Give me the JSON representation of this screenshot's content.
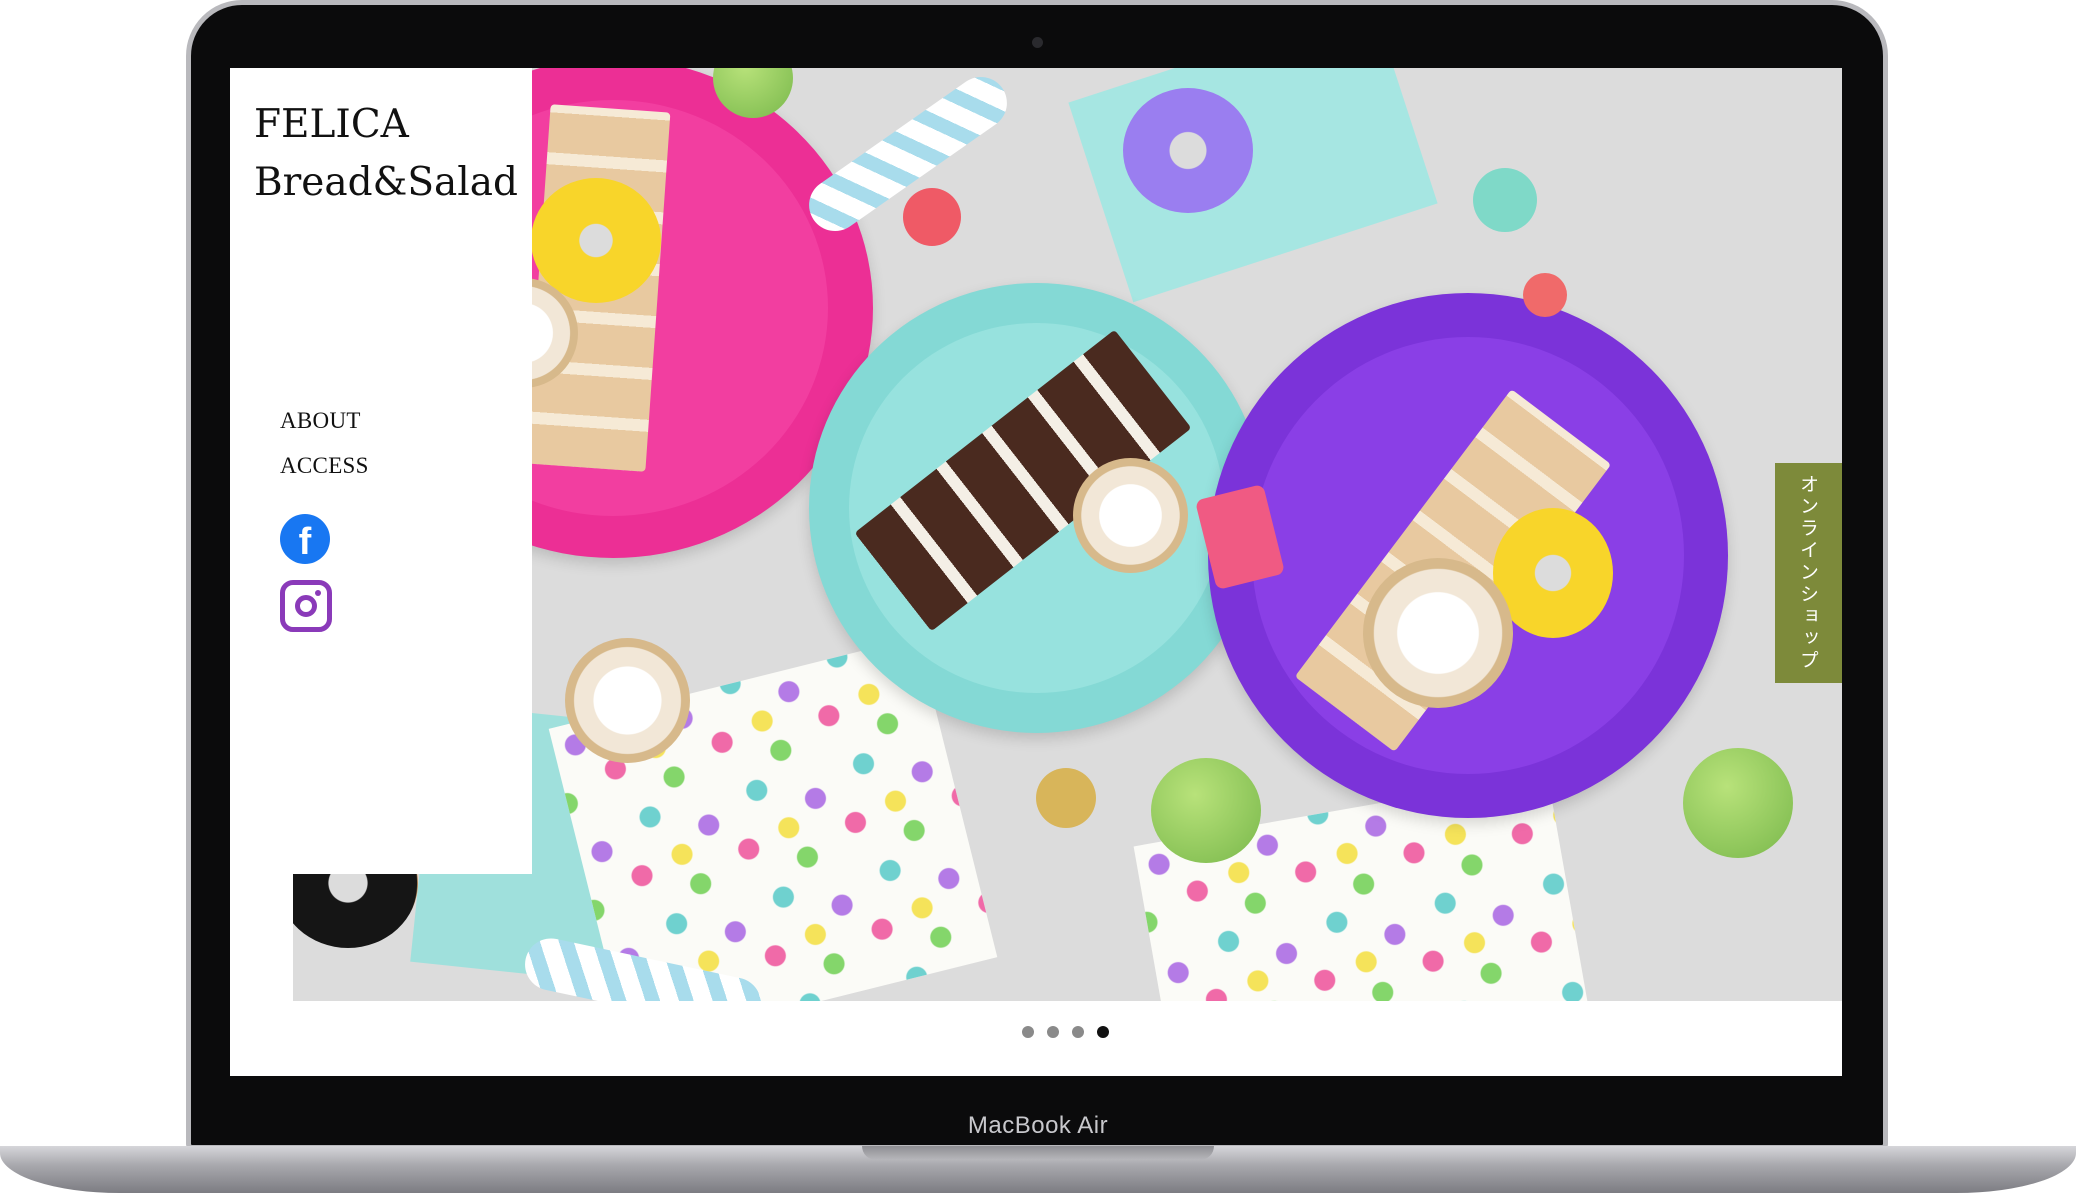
{
  "device": {
    "label": "MacBook Air"
  },
  "site": {
    "logo_line1": "FELICA",
    "logo_line2": "Bread&Salad"
  },
  "nav": {
    "items": [
      {
        "label": "ABOUT"
      },
      {
        "label": "ACCESS"
      }
    ]
  },
  "social": {
    "facebook_glyph": "f",
    "icons": [
      "facebook-icon",
      "instagram-icon"
    ]
  },
  "side_tab": {
    "label": "オンラインショップ",
    "color": "#7d8a3a"
  },
  "carousel": {
    "slide_count": 4,
    "active_index": 3
  },
  "colors": {
    "facebook": "#1877f2",
    "instagram": "#8a3ab9",
    "accent_green": "#7d8a3a"
  }
}
